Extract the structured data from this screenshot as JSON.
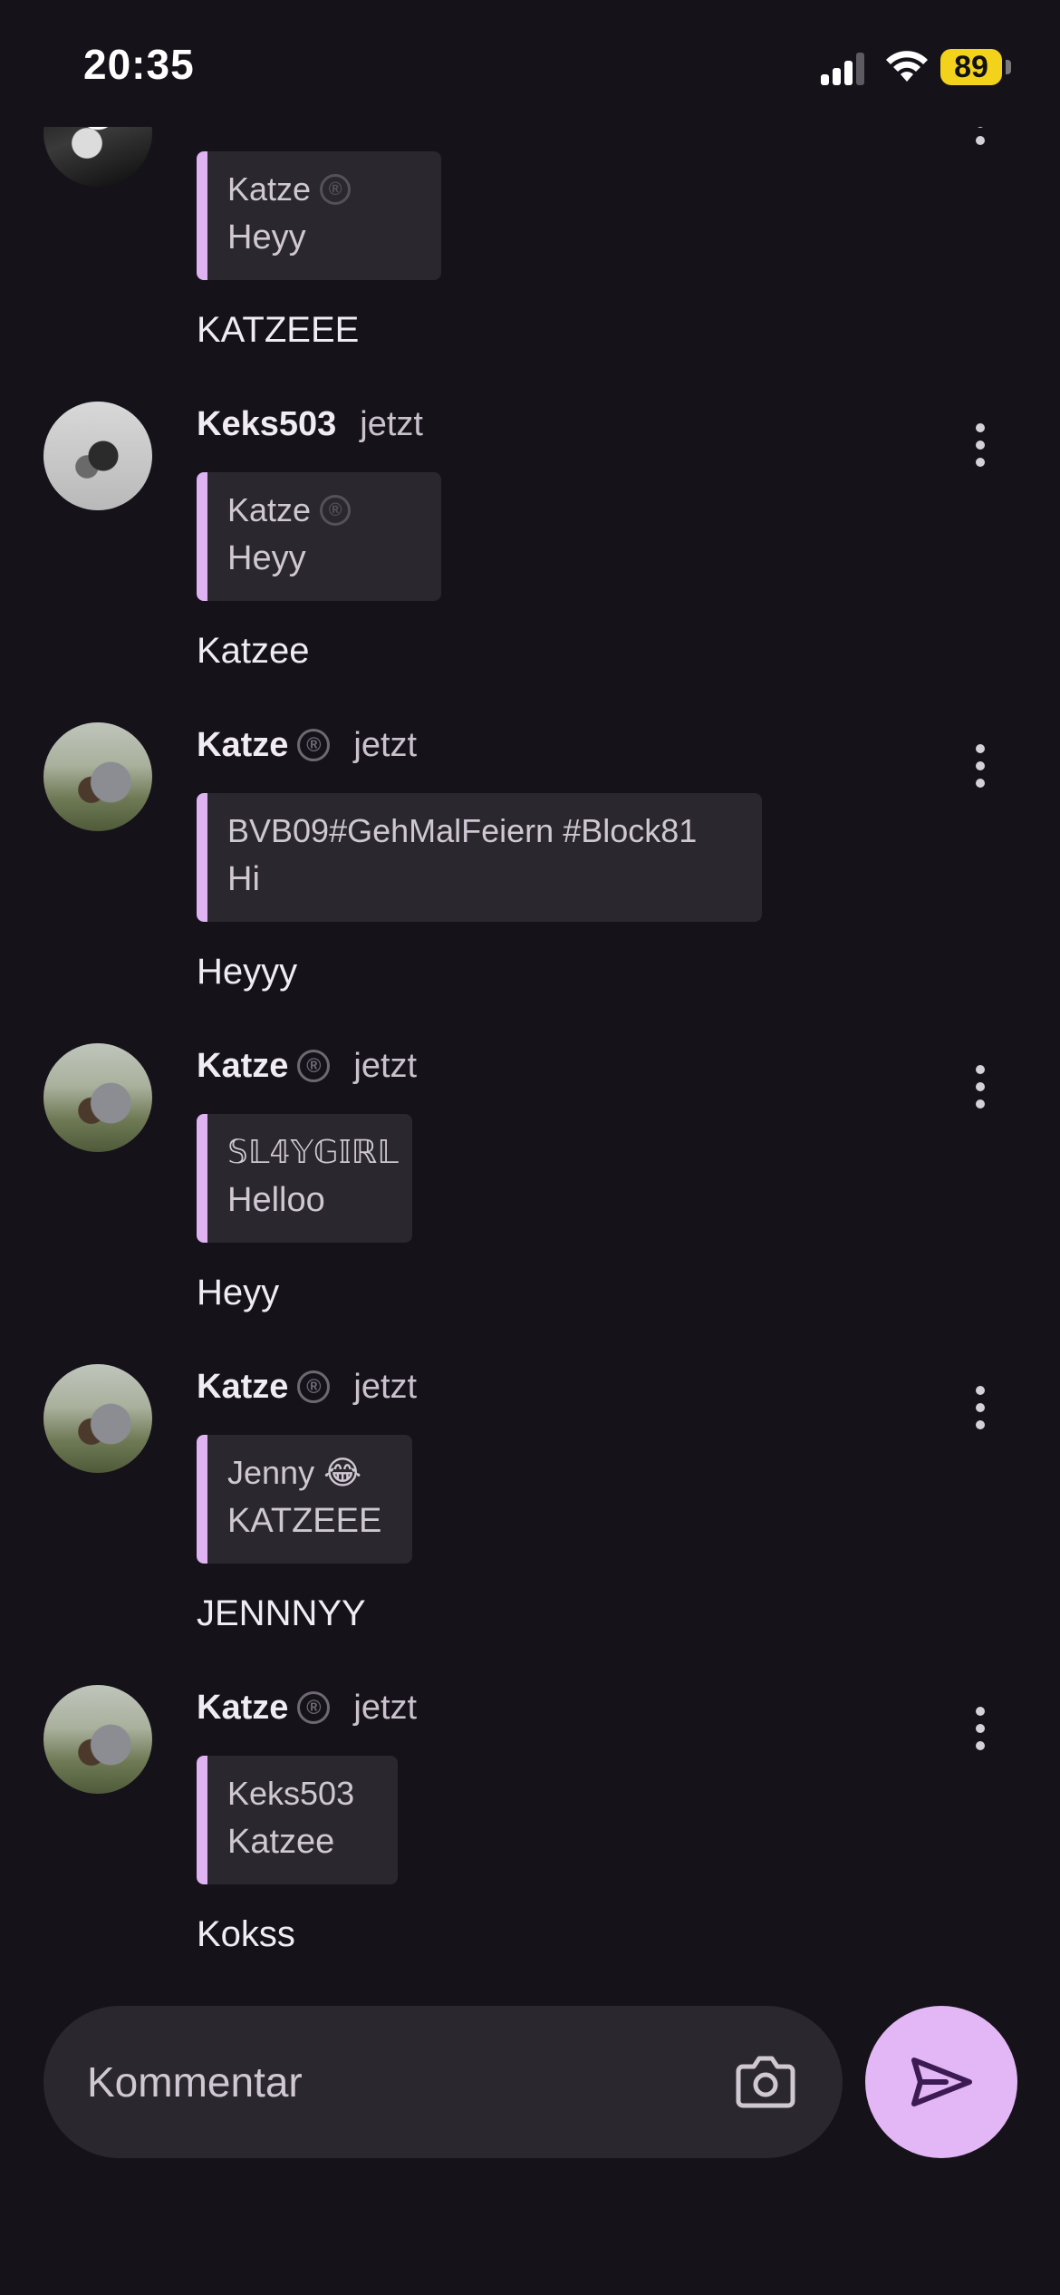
{
  "status_bar": {
    "time": "20:35",
    "battery": "89"
  },
  "comments": [
    {
      "author": "",
      "time": "",
      "quote_author": "Katze",
      "quote_text": "Heyy",
      "text": "KATZEEE"
    },
    {
      "author": "Keks503",
      "time": "jetzt",
      "quote_author": "Katze",
      "quote_text": "Heyy",
      "text": "Katzee"
    },
    {
      "author": "Katze",
      "time": "jetzt",
      "quote_author": "BVB09#GehMalFeiern #Block81",
      "quote_text": "Hi",
      "text": "Heyyy"
    },
    {
      "author": "Katze",
      "time": "jetzt",
      "quote_author": "𝕊𝕃𝟜𝕐𝔾𝕀ℝ𝕃",
      "quote_text": "Helloo",
      "text": "Heyy"
    },
    {
      "author": "Katze",
      "time": "jetzt",
      "quote_author": "Jenny 😂",
      "quote_text": "KATZEEE",
      "text": "JENNNYY"
    },
    {
      "author": "Katze",
      "time": "jetzt",
      "quote_author": "Keks503",
      "quote_text": "Katzee",
      "text": "Kokss"
    }
  ],
  "composer": {
    "placeholder": "Kommentar"
  },
  "verified_symbol": "®",
  "colors": {
    "background": "#16121a",
    "accent": "#e3b6f5",
    "quote_bar": "#dfb2f2",
    "surface": "#2b272e"
  }
}
